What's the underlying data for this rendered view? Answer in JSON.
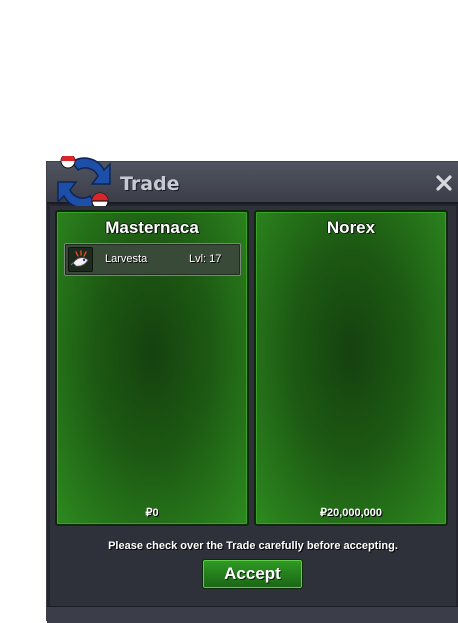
{
  "window": {
    "title": "Trade",
    "close_icon": "close-icon",
    "logo_icon": "trade-arrows-icon"
  },
  "players": [
    {
      "name": "Masternaca",
      "items": [
        {
          "icon": "larvesta-icon",
          "name": "Larvesta",
          "level": "Lvl: 17"
        }
      ],
      "money": "0"
    },
    {
      "name": "Norex",
      "items": [],
      "money": "20,000,000"
    }
  ],
  "notice": "Please check over the Trade carefully before accepting.",
  "accept_label": "Accept",
  "colors": {
    "panel_green": "#1d5a13",
    "panel_border": "#3aa12a",
    "accept_green": "#2f9b24",
    "window_bg": "#24252e"
  }
}
